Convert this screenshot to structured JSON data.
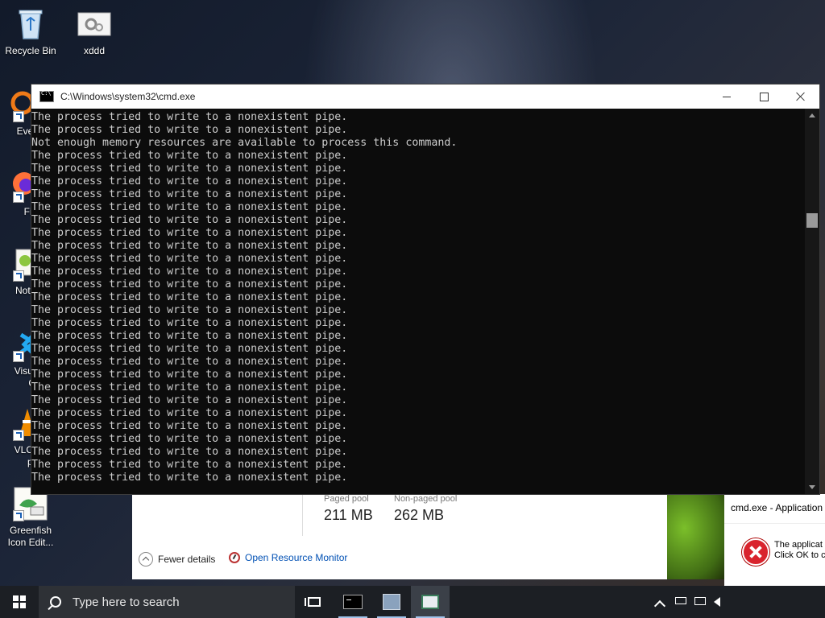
{
  "desktop": {
    "icons": [
      {
        "label": "Recycle Bin"
      },
      {
        "label": "xddd"
      },
      {
        "label": "Every"
      },
      {
        "label": "Fire"
      },
      {
        "label": "Notep"
      },
      {
        "label": "Visual",
        "label2": "Co"
      },
      {
        "label": "VLC r",
        "label2": "pla"
      },
      {
        "label": "Greenfish",
        "label2": "Icon Edit..."
      }
    ]
  },
  "cmd_window": {
    "title": "C:\\Windows\\system32\\cmd.exe",
    "lines": [
      "The process tried to write to a nonexistent pipe.",
      "The process tried to write to a nonexistent pipe.",
      "Not enough memory resources are available to process this command.",
      "The process tried to write to a nonexistent pipe.",
      "The process tried to write to a nonexistent pipe.",
      "The process tried to write to a nonexistent pipe.",
      "The process tried to write to a nonexistent pipe.",
      "The process tried to write to a nonexistent pipe.",
      "The process tried to write to a nonexistent pipe.",
      "The process tried to write to a nonexistent pipe.",
      "The process tried to write to a nonexistent pipe.",
      "The process tried to write to a nonexistent pipe.",
      "The process tried to write to a nonexistent pipe.",
      "The process tried to write to a nonexistent pipe.",
      "The process tried to write to a nonexistent pipe.",
      "The process tried to write to a nonexistent pipe.",
      "The process tried to write to a nonexistent pipe.",
      "The process tried to write to a nonexistent pipe.",
      "The process tried to write to a nonexistent pipe.",
      "The process tried to write to a nonexistent pipe.",
      "The process tried to write to a nonexistent pipe.",
      "The process tried to write to a nonexistent pipe.",
      "The process tried to write to a nonexistent pipe.",
      "The process tried to write to a nonexistent pipe.",
      "The process tried to write to a nonexistent pipe.",
      "The process tried to write to a nonexistent pipe.",
      "The process tried to write to a nonexistent pipe.",
      "The process tried to write to a nonexistent pipe.",
      "The process tried to write to a nonexistent pipe."
    ]
  },
  "task_manager": {
    "paged_pool_label": "Paged pool",
    "paged_pool_value": "211 MB",
    "nonpaged_pool_label": "Non-paged pool",
    "nonpaged_pool_value": "262 MB",
    "fewer_details": "Fewer details",
    "open_resource_monitor": "Open Resource Monitor"
  },
  "error_dialog": {
    "title": "cmd.exe - Application",
    "message_line1": "The applicat",
    "message_line2": "Click OK to c"
  },
  "taskbar": {
    "search_placeholder": "Type here to search"
  },
  "colors": {
    "console_bg": "#0c0c0c",
    "console_text": "#cccccc",
    "taskbar_bg": "#1c1f24",
    "link": "#0050b4",
    "error_red": "#d9232d"
  }
}
